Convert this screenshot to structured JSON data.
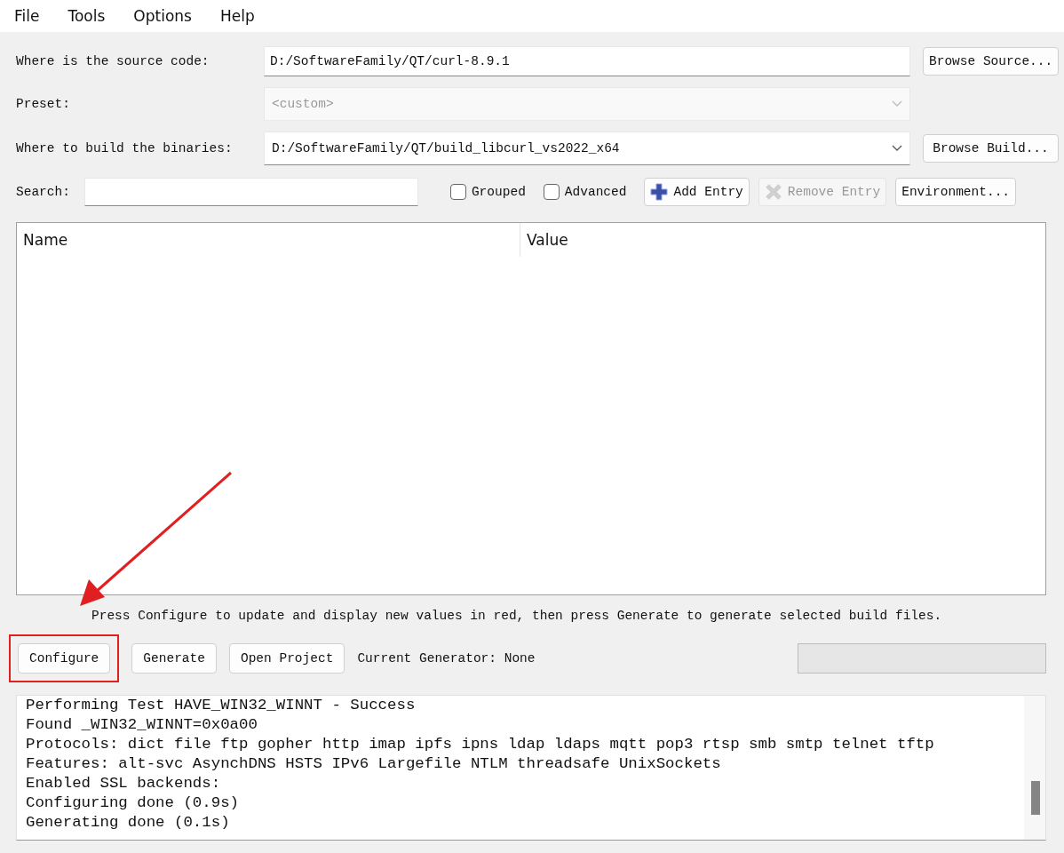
{
  "menu": [
    "File",
    "Tools",
    "Options",
    "Help"
  ],
  "source": {
    "label": "Where is the source code:",
    "value": "D:/SoftwareFamily/QT/curl-8.9.1",
    "button": "Browse Source..."
  },
  "preset": {
    "label": "Preset:",
    "value": "<custom>",
    "disabled": true
  },
  "build": {
    "label": "Where to build the binaries:",
    "value": "D:/SoftwareFamily/QT/build_libcurl_vs2022_x64",
    "button": "Browse Build..."
  },
  "search": {
    "label": "Search:"
  },
  "options": [
    {
      "label": "Grouped",
      "checked": false
    },
    {
      "label": "Advanced",
      "checked": false
    }
  ],
  "entry_buttons": [
    {
      "label": "Add Entry",
      "kind": "add",
      "disabled": false
    },
    {
      "label": "Remove Entry",
      "kind": "remove",
      "disabled": true
    },
    {
      "label": "Environment...",
      "kind": "plain",
      "disabled": false
    }
  ],
  "table": {
    "columns": [
      "Name",
      "Value"
    ]
  },
  "hint": "Press Configure to update and display new values in red, then press Generate to generate selected build files.",
  "actions": [
    {
      "label": "Configure",
      "highlighted": true
    },
    {
      "label": "Generate",
      "highlighted": false
    },
    {
      "label": "Open Project",
      "highlighted": false
    }
  ],
  "generator": "Current Generator: None",
  "progress": {
    "level": 0
  },
  "log": [
    "Performing Test HAVE_WIN32_WINNT - Success",
    "Found _WIN32_WINNT=0x0a00",
    "Protocols: dict file ftp gopher http imap ipfs ipns ldap ldaps mqtt pop3 rtsp smb smtp telnet tftp",
    "Features: alt-svc AsynchDNS HSTS IPv6 Largefile NTLM threadsafe UnixSockets",
    "Enabled SSL backends:",
    "Configuring done (0.9s)",
    "Generating done (0.1s)"
  ]
}
